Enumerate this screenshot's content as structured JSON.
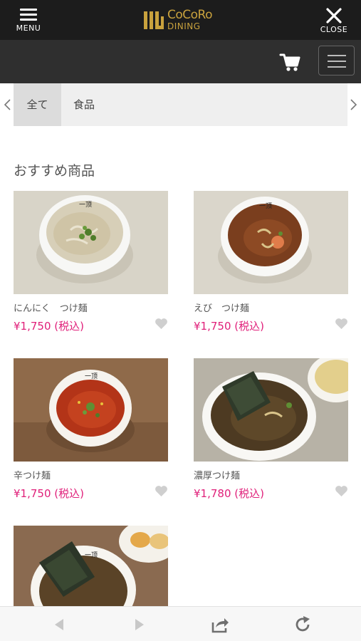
{
  "header": {
    "menu_label": "MENU",
    "close_label": "CLOSE",
    "logo_line1": "CoCoRo",
    "logo_line2": "DINING",
    "brand_color": "#c9a23d"
  },
  "toolbar": {
    "cart_icon": "cart-icon",
    "list_menu_icon": "list-menu-icon"
  },
  "categories": [
    {
      "label": "全て",
      "active": true
    },
    {
      "label": "食品",
      "active": false
    }
  ],
  "section": {
    "title": "おすすめ商品"
  },
  "products": [
    {
      "name": "にんにく　つけ麺",
      "price": "¥1,750 (税込)"
    },
    {
      "name": "えび　つけ麺",
      "price": "¥1,750 (税込)"
    },
    {
      "name": "辛つけ麺",
      "price": "¥1,750 (税込)"
    },
    {
      "name": "濃厚つけ麺",
      "price": "¥1,780 (税込)"
    },
    {
      "name": "",
      "price": ""
    }
  ],
  "colors": {
    "price": "#e0207a",
    "header_bg": "#1c1c1c",
    "subbar_bg": "#2f2f2f"
  },
  "browser_bar": {
    "icons": [
      "back-icon",
      "forward-icon",
      "share-icon",
      "reload-icon"
    ]
  }
}
